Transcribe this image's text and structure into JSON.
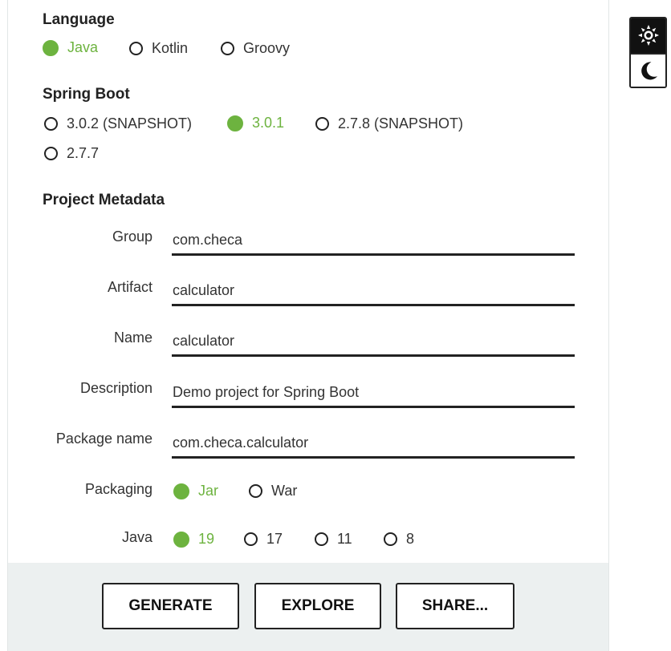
{
  "language": {
    "title": "Language",
    "options": [
      {
        "label": "Java",
        "selected": true
      },
      {
        "label": "Kotlin",
        "selected": false
      },
      {
        "label": "Groovy",
        "selected": false
      }
    ]
  },
  "spring_boot": {
    "title": "Spring Boot",
    "options": [
      {
        "label": "3.0.2 (SNAPSHOT)",
        "selected": false
      },
      {
        "label": "3.0.1",
        "selected": true
      },
      {
        "label": "2.7.8 (SNAPSHOT)",
        "selected": false
      },
      {
        "label": "2.7.7",
        "selected": false
      }
    ]
  },
  "metadata": {
    "title": "Project Metadata",
    "group": {
      "label": "Group",
      "value": "com.checa"
    },
    "artifact": {
      "label": "Artifact",
      "value": "calculator"
    },
    "name": {
      "label": "Name",
      "value": "calculator"
    },
    "description": {
      "label": "Description",
      "value": "Demo project for Spring Boot"
    },
    "package_name": {
      "label": "Package name",
      "value": "com.checa.calculator"
    },
    "packaging": {
      "label": "Packaging",
      "options": [
        {
          "label": "Jar",
          "selected": true
        },
        {
          "label": "War",
          "selected": false
        }
      ]
    },
    "java": {
      "label": "Java",
      "options": [
        {
          "label": "19",
          "selected": true
        },
        {
          "label": "17",
          "selected": false
        },
        {
          "label": "11",
          "selected": false
        },
        {
          "label": "8",
          "selected": false
        }
      ]
    }
  },
  "footer": {
    "generate_label": "GENERATE",
    "explore_label": "EXPLORE",
    "share_label": "SHARE..."
  },
  "theme": {
    "light_icon": "sun-icon",
    "dark_icon": "moon-icon"
  },
  "colors": {
    "accent": "#6db33f",
    "footer_bg": "#ecf0f0",
    "text": "#222222"
  }
}
